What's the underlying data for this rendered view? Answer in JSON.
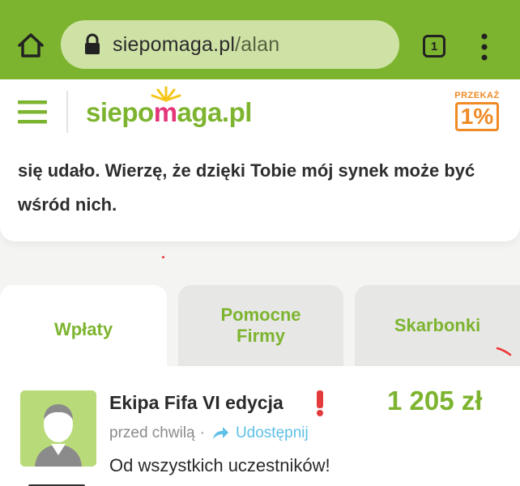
{
  "browser": {
    "url_domain": "siepomaga.pl",
    "url_path": "/alan",
    "tab_count": "1",
    "bar_color": "#7db42f"
  },
  "header": {
    "logo_part1": "siepo",
    "logo_part2": "m",
    "logo_part3": "aga.pl",
    "przekaz_label": "PRZEKAŻ",
    "przekaz_value": "1%"
  },
  "story": {
    "text": "się udało. Wierzę, że dzięki Tobie mój synek może być wśród nich."
  },
  "tabs": [
    {
      "label": "Wpłaty",
      "active": true
    },
    {
      "label": "Pomocne Firmy",
      "active": false
    },
    {
      "label": "Skarbonki",
      "active": false
    }
  ],
  "donations": [
    {
      "name": "Ekipa Fifa VI edycja",
      "amount": "1 205 zł",
      "time": "przed chwilą",
      "separator": "·",
      "share_label": "Udostępnij",
      "message": "Od wszystkich uczestników!"
    }
  ],
  "colors": {
    "brand_green": "#7db42f",
    "brand_pink": "#e4357a",
    "accent_orange": "#f08a24",
    "link_blue": "#5ec0e6"
  },
  "icons": [
    "home-icon",
    "lock-icon",
    "tabs-icon",
    "more-vert-icon",
    "hamburger-icon",
    "share-icon",
    "exclamation-icon",
    "user-avatar-icon"
  ]
}
